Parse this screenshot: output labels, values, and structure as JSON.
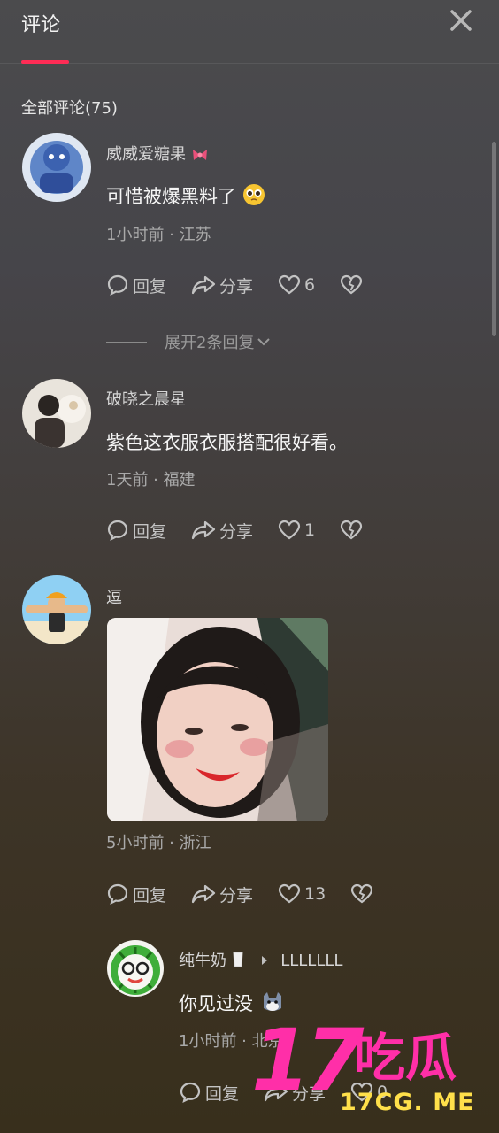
{
  "header": {
    "title": "评论",
    "close_icon": "close-icon"
  },
  "count_label": "全部评论(75)",
  "comments": [
    {
      "username": "威威爱糖果",
      "text": "可惜被爆黑料了",
      "meta": "1小时前 · 江苏",
      "reply_label": "回复",
      "share_label": "分享",
      "likes": "6",
      "expand_label": "展开2条回复"
    },
    {
      "username": "破晓之晨星",
      "text": "紫色这衣服衣服搭配很好看。",
      "meta": "1天前 · 福建",
      "reply_label": "回复",
      "share_label": "分享",
      "likes": "1"
    },
    {
      "username": "逗",
      "meta": "5小时前 · 浙江",
      "reply_label": "回复",
      "share_label": "分享",
      "likes": "13"
    }
  ],
  "reply": {
    "username": "纯牛奶",
    "reply_to": "LLLLLLL",
    "text": "你见过没",
    "meta": "1小时前 · 北京",
    "reply_label": "回复",
    "share_label": "分享",
    "likes": "0"
  },
  "watermark": {
    "number": "17",
    "chinese": "吃瓜",
    "url": "17CG. ME"
  },
  "colors": {
    "accent": "#fe2c55",
    "watermark_pink": "#ff2fa8",
    "watermark_yellow": "#ffe04a"
  }
}
